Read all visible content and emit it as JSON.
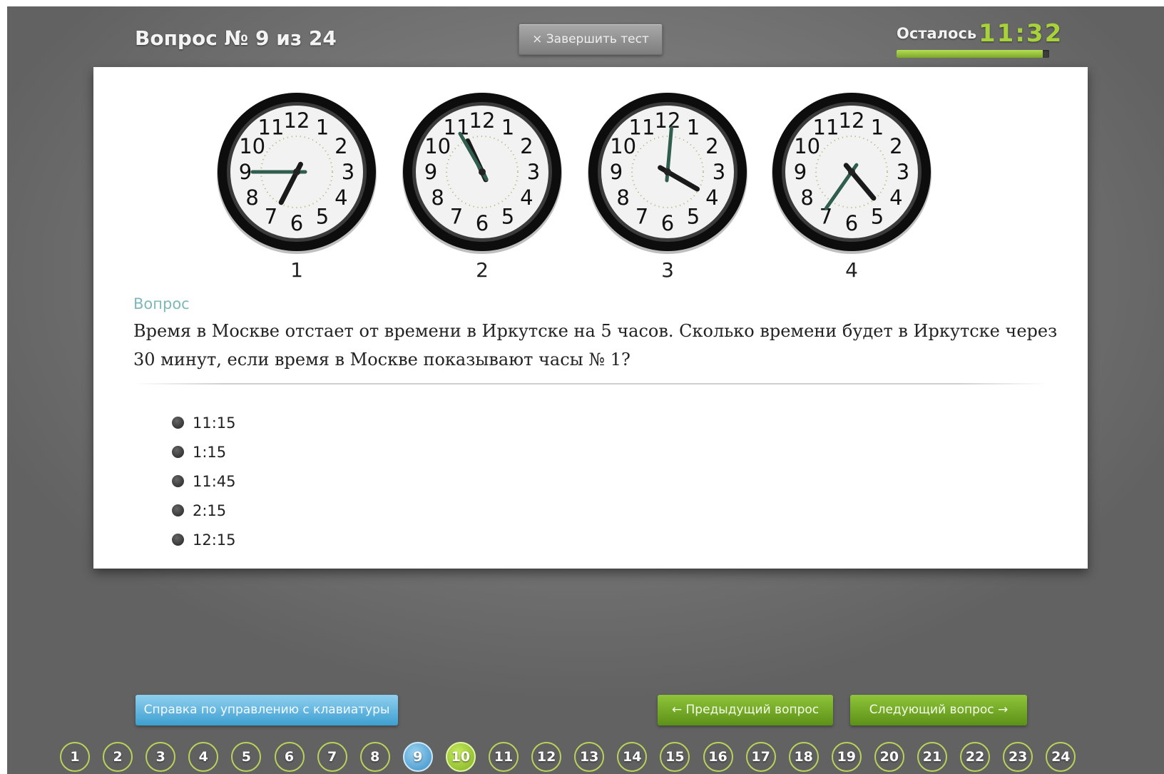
{
  "header": {
    "question_title": "Вопрос № 9 из 24",
    "finish_label": "× Завершить тест",
    "timer_label": "Осталось",
    "timer_value": "11:32",
    "timer_progress": 0.96
  },
  "clocks": [
    {
      "label": "1",
      "hour_deg": 207,
      "minute_deg": 270
    },
    {
      "label": "2",
      "hour_deg": 335,
      "minute_deg": 330
    },
    {
      "label": "3",
      "hour_deg": 120,
      "minute_deg": 5
    },
    {
      "label": "4",
      "hour_deg": 140,
      "minute_deg": 215
    }
  ],
  "clock_face": {
    "numbers": [
      "12",
      "1",
      "2",
      "3",
      "4",
      "5",
      "6",
      "7",
      "8",
      "9",
      "10",
      "11"
    ],
    "hand_color": "#1a1a1a",
    "minute_hand_color": "#2f5e4e"
  },
  "question": {
    "label": "Вопрос",
    "text": "Время в Москве отстает от времени в Иркутске на 5 часов. Сколько времени будет в Иркутске через 30 минут, если время в Москве показывают часы № 1?"
  },
  "answers": [
    "11:15",
    "1:15",
    "11:45",
    "2:15",
    "12:15"
  ],
  "footer": {
    "help_label": "Справка по управлению с клавиатуры",
    "prev_label": "← Предыдущий вопрос",
    "next_label": "Следующий вопрос →"
  },
  "pages": {
    "items": [
      "1",
      "2",
      "3",
      "4",
      "5",
      "6",
      "7",
      "8",
      "9",
      "10",
      "11",
      "12",
      "13",
      "14",
      "15",
      "16",
      "17",
      "18",
      "19",
      "20",
      "21",
      "22",
      "23",
      "24"
    ],
    "current": "9",
    "highlighted": "10"
  },
  "colors": {
    "accent_green": "#a8d23a",
    "accent_blue": "#3e9fd0"
  }
}
